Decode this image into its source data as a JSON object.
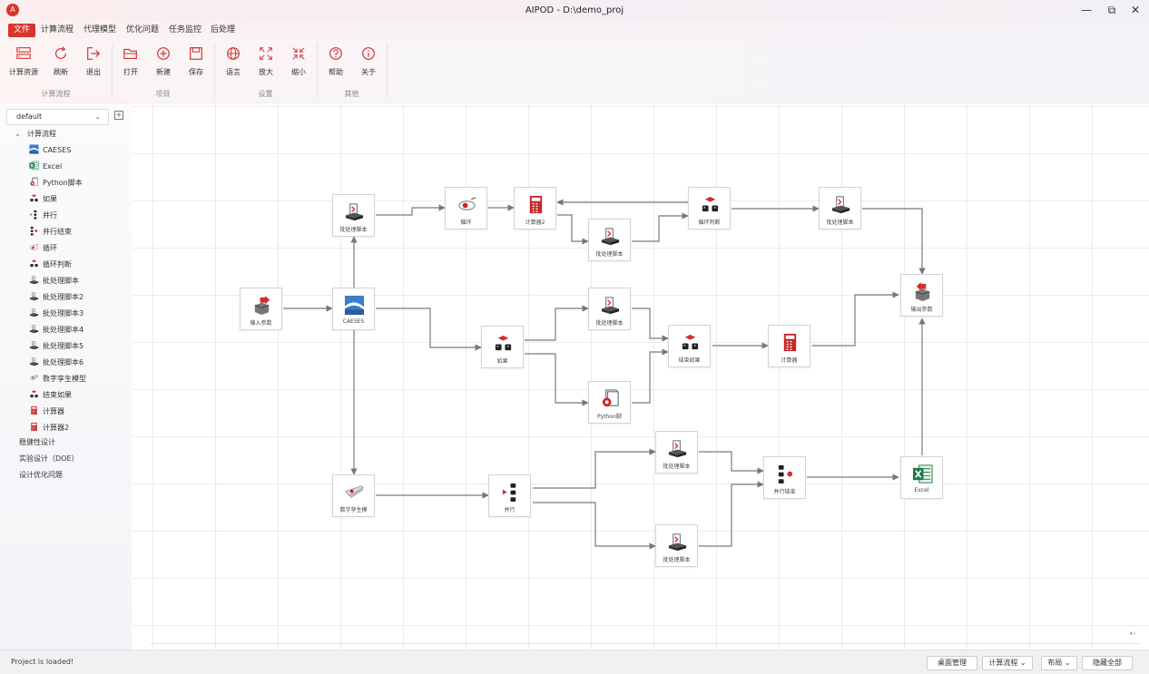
{
  "window": {
    "title": "AIPOD - D:\\demo_proj",
    "logo": "A",
    "minimize": "—",
    "restore": "⧉",
    "close": "✕"
  },
  "menu": {
    "items": [
      "文件",
      "计算流程",
      "代理模型",
      "优化问题",
      "任务监控",
      "后处理"
    ],
    "collapse": "⌃"
  },
  "ribbon": {
    "buttons": [
      {
        "label": "计算资源",
        "icon": "server-icon"
      },
      {
        "label": "刷新",
        "icon": "refresh-icon"
      },
      {
        "label": "退出",
        "icon": "exit-icon"
      },
      {
        "label": "打开",
        "icon": "folder-open-icon"
      },
      {
        "label": "新建",
        "icon": "plus-circle-icon"
      },
      {
        "label": "保存",
        "icon": "save-icon"
      },
      {
        "label": "语言",
        "icon": "globe-icon"
      },
      {
        "label": "放大",
        "icon": "expand-icon"
      },
      {
        "label": "缩小",
        "icon": "shrink-icon"
      },
      {
        "label": "帮助",
        "icon": "help-icon"
      },
      {
        "label": "关于",
        "icon": "info-icon"
      }
    ],
    "groups": [
      "计算流程",
      "项目",
      "设置",
      "其他"
    ]
  },
  "sidebar": {
    "project": "default",
    "tree_root": "计算流程",
    "items": [
      "CAESES",
      "Excel",
      "Python脚本",
      "如果",
      "并行",
      "并行结束",
      "循环",
      "循环判断",
      "批处理脚本",
      "批处理脚本2",
      "批处理脚本3",
      "批处理脚本4",
      "批处理脚本5",
      "批处理脚本6",
      "数字孪生模型",
      "结束如果",
      "计算器",
      "计算器2"
    ],
    "sections": [
      "稳健性设计",
      "实验设计（DOE）",
      "设计优化问题"
    ]
  },
  "canvas": {
    "collapse": "⇠",
    "nodes": {
      "input": "输入参数",
      "caeses": "CAESES",
      "batch_top": "批处理脚本",
      "loop": "循环",
      "calc2": "计算器2",
      "batch_mid": "批处理脚本",
      "loop_judge": "循环判断",
      "batch_tr": "批处理脚本",
      "output": "输出参数",
      "if": "如果",
      "batch_if": "批处理脚本",
      "python": "Python脚",
      "end_if": "结束如果",
      "calc": "计算器",
      "twin": "数字孪生模",
      "parallel": "并行",
      "batch_p1": "批处理脚本",
      "batch_p2": "批处理脚本",
      "par_end": "并行结束",
      "excel": "Excel"
    }
  },
  "status": {
    "text": "Project is loaded!",
    "buttons": [
      "桌面管理",
      "计算流程 ⌄",
      "布局 ⌄",
      "隐藏全部"
    ]
  }
}
